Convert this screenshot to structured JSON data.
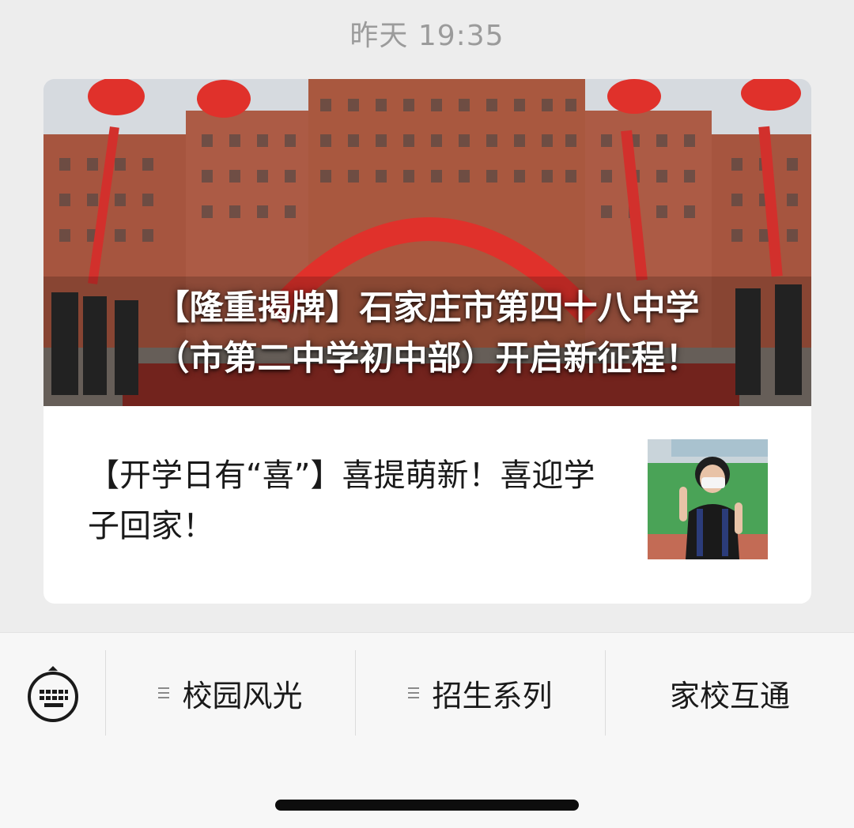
{
  "timestamp": "昨天 19:35",
  "hero_article": {
    "title_line1": "【隆重揭牌】石家庄市第四十八中学",
    "title_line2": "（市第二中学初中部）开启新征程！",
    "image_icon": "school-building-photo"
  },
  "second_article": {
    "title": "【开学日有“喜”】喜提萌新！喜迎学子回家！",
    "thumbnail_icon": "student-photo"
  },
  "menu": {
    "keyboard_icon": "keyboard-icon",
    "items": [
      {
        "label": "校园风光",
        "has_submenu": true
      },
      {
        "label": "招生系列",
        "has_submenu": true
      },
      {
        "label": "家校互通",
        "has_submenu": false
      }
    ]
  },
  "colors": {
    "background": "#ededed",
    "card": "#ffffff",
    "menu_bar": "#f7f7f7",
    "timestamp_text": "#9b9b9b"
  }
}
